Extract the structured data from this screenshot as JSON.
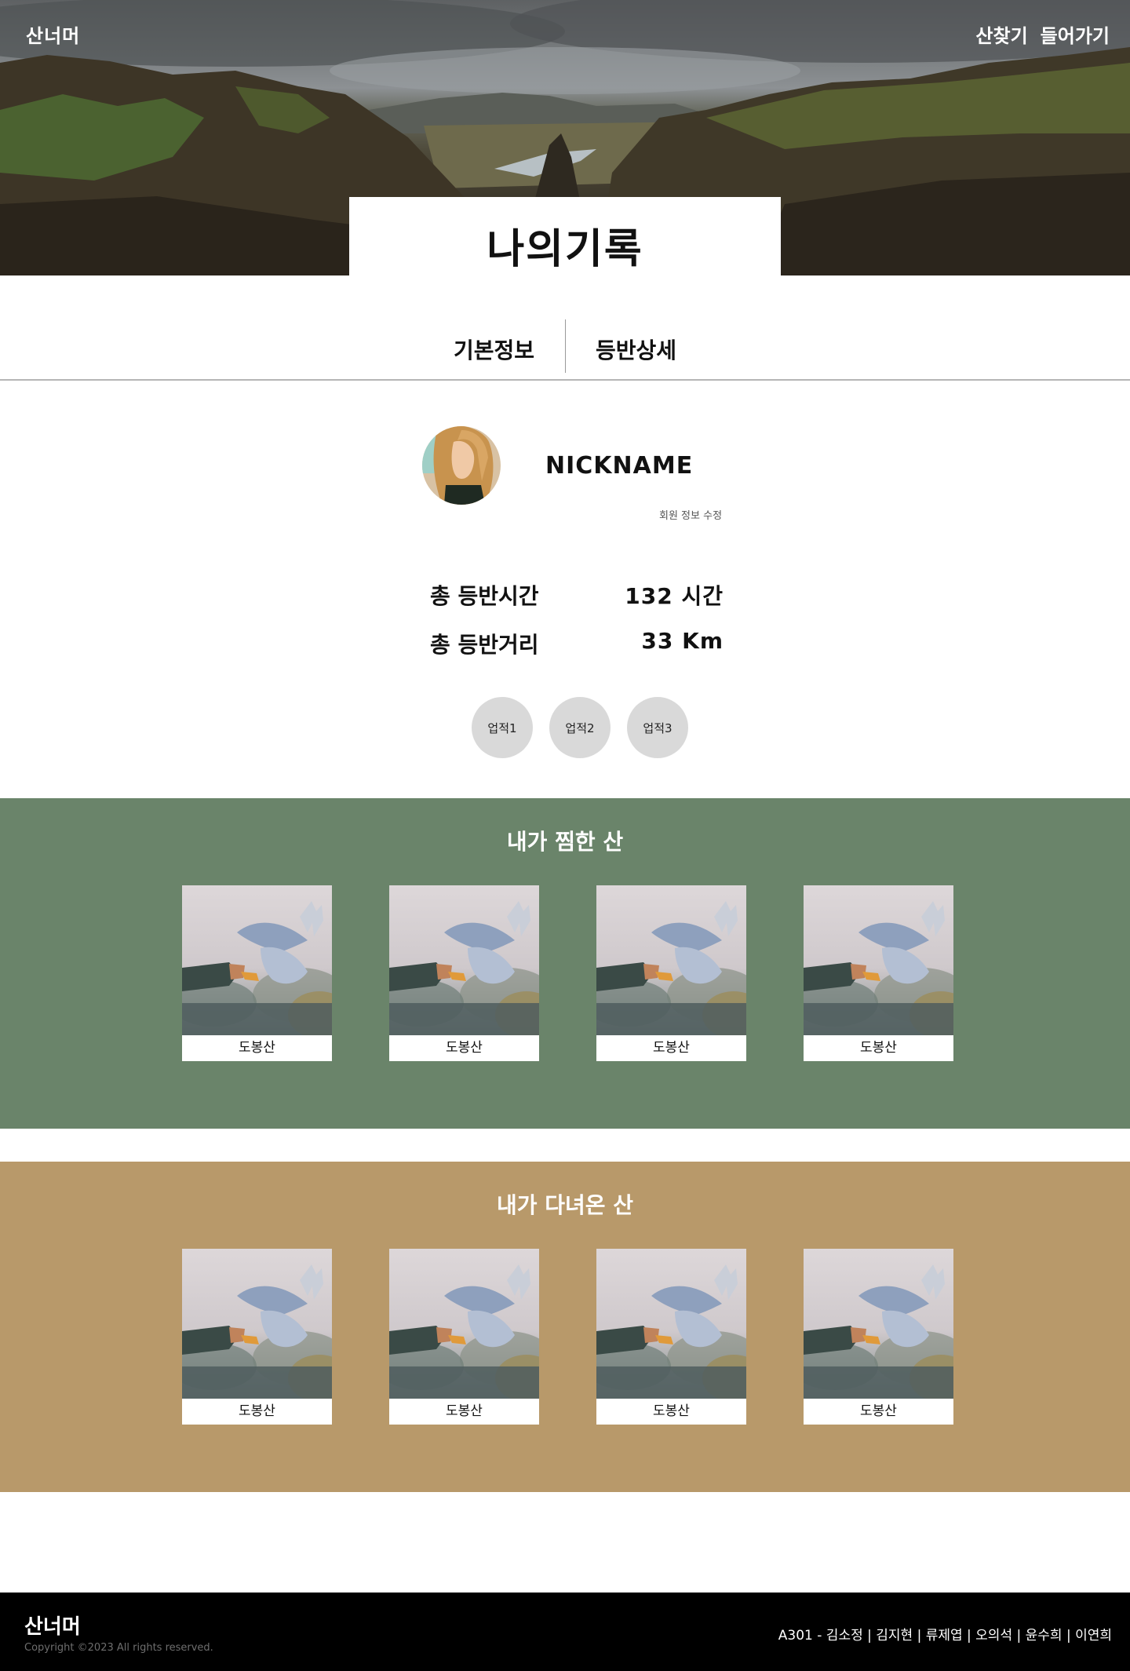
{
  "nav": {
    "logo": "산너머",
    "links": [
      "산찾기",
      "들어가기"
    ]
  },
  "hero": {
    "title": "나의기록"
  },
  "tabs": [
    "기본정보",
    "등반상세"
  ],
  "profile": {
    "nickname": "NICKNAME",
    "edit_label": "회원 정보 수정"
  },
  "stats": [
    {
      "label": "총 등반시간",
      "value": "132 시간"
    },
    {
      "label": "총 등반거리",
      "value": "33 Km"
    }
  ],
  "badges": [
    "업적1",
    "업적2",
    "업적3"
  ],
  "favorite_section": {
    "title": "내가 찜한 산",
    "background": "#6a846a",
    "cards": [
      "도봉산",
      "도봉산",
      "도봉산",
      "도봉산"
    ]
  },
  "visited_section": {
    "title": "내가 다녀온 산",
    "background": "#b8996a",
    "cards": [
      "도봉산",
      "도봉산",
      "도봉산",
      "도봉산"
    ]
  },
  "footer": {
    "logo": "산너머",
    "copyright": "Copyright ©2023 All rights reserved.",
    "team": "A301 - 김소정 | 김지현 | 류제엽 | 오의석 | 윤수희 | 이연희"
  }
}
